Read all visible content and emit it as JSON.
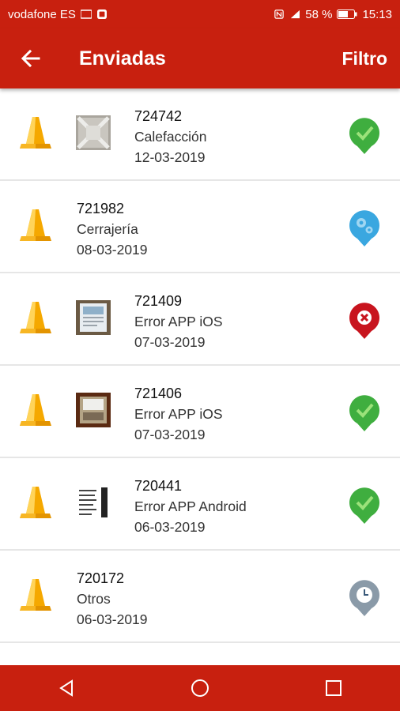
{
  "status_bar": {
    "carrier": "vodafone ES",
    "battery": "58 %",
    "time": "15:13"
  },
  "app_bar": {
    "title": "Enviadas",
    "filter_label": "Filtro",
    "back_icon": "arrow-left-icon"
  },
  "items": [
    {
      "id": "724742",
      "category": "Calefacción",
      "date": "12-03-2019",
      "thumbnail": "ceiling-unit-photo",
      "status": "completed"
    },
    {
      "id": "721982",
      "category": "Cerrajería",
      "date": "08-03-2019",
      "thumbnail": "",
      "status": "in-process"
    },
    {
      "id": "721409",
      "category": "Error APP iOS",
      "date": "07-03-2019",
      "thumbnail": "app-screenshot-photo",
      "status": "rejected"
    },
    {
      "id": "721406",
      "category": "Error APP iOS",
      "date": "07-03-2019",
      "thumbnail": "app-screenshot-photo",
      "status": "completed"
    },
    {
      "id": "720441",
      "category": "Error APP Android",
      "date": "06-03-2019",
      "thumbnail": "app-screenshot-photo",
      "status": "completed"
    },
    {
      "id": "720172",
      "category": "Otros",
      "date": "06-03-2019",
      "thumbnail": "",
      "status": "pending"
    }
  ],
  "nav_bar": {
    "back_icon": "triangle-back-icon",
    "home_icon": "circle-home-icon",
    "recents_icon": "square-recents-icon"
  },
  "colors": {
    "primary": "#c8200f",
    "cone": "#f5a800",
    "completed": "#3fae3f",
    "in_process": "#3aa7e0",
    "rejected": "#c8141e",
    "pending": "#8a9aa8"
  }
}
